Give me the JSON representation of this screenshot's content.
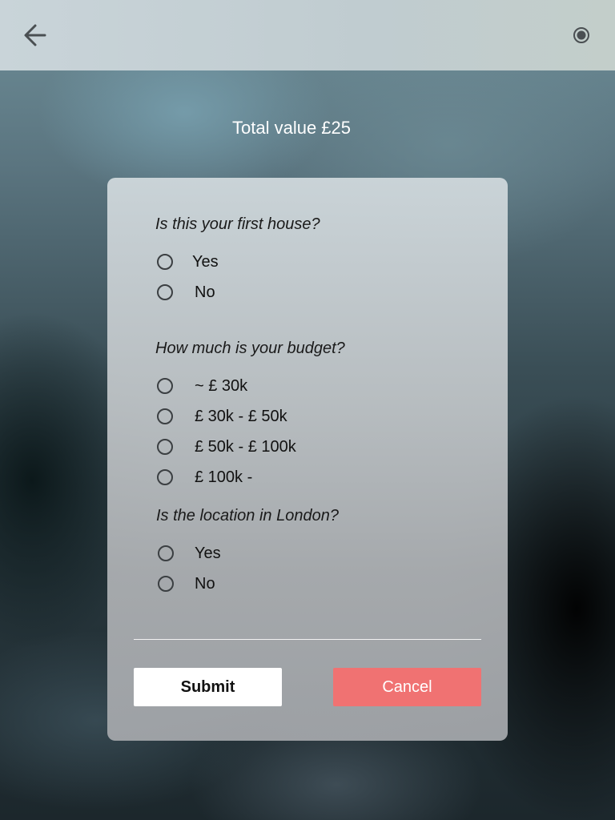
{
  "header": {
    "back_icon": "arrow-left-icon",
    "record_icon": "radio-target-icon"
  },
  "total": {
    "label": "Total value £25"
  },
  "form": {
    "questions": [
      {
        "text": "Is this your first house?",
        "options": [
          "Yes",
          "No"
        ]
      },
      {
        "text": "How much is your budget?",
        "options": [
          "~ £ 30k",
          "£ 30k - £ 50k",
          "£ 50k - £ 100k",
          "£ 100k -"
        ]
      },
      {
        "text": "Is the location in London?",
        "options": [
          "Yes",
          "No"
        ]
      }
    ],
    "submit_label": "Submit",
    "cancel_label": "Cancel"
  },
  "colors": {
    "cancel": "#f07272",
    "submit": "#ffffff",
    "topbar": "#c4cfd3"
  }
}
